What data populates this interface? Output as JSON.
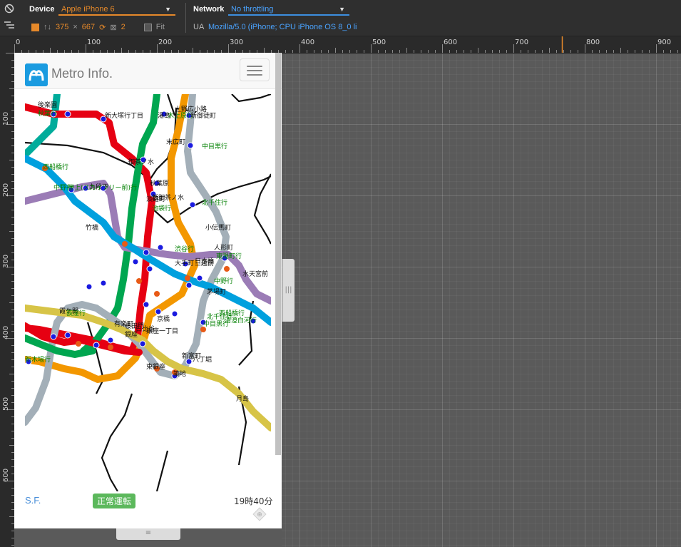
{
  "toolbar": {
    "device_label": "Device",
    "device_value": "Apple iPhone 6",
    "network_label": "Network",
    "network_value": "No throttling",
    "width": "375",
    "times": "×",
    "height": "667",
    "dpr": "2",
    "fit_label": "Fit",
    "ua_label": "UA",
    "ua_value": "Mozilla/5.0 (iPhone; CPU iPhone OS 8_0 li"
  },
  "ruler_top_labels": [
    "0",
    "100",
    "200",
    "300",
    "400",
    "500",
    "600",
    "700",
    "800",
    "900"
  ],
  "ruler_left_labels": [
    "100",
    "200",
    "300",
    "400",
    "500",
    "600"
  ],
  "app": {
    "brand": "Metro Info.",
    "footer_left": "S.F.",
    "status": "正常運転",
    "time": "19時40分"
  },
  "map": {
    "colors": {
      "red": "#e60012",
      "green": "#00a650",
      "orange": "#f39700",
      "gray": "#a3afb8",
      "purple": "#9b7cb6",
      "sky": "#00a0de",
      "teal": "#00ac9b",
      "gold": "#d7c447",
      "station": "#1a1adf",
      "train": "#e85a16",
      "label_green": "#008000"
    },
    "labels": [
      {
        "t": "後楽園",
        "c": "k"
      },
      {
        "t": "秋葉行",
        "c": "g"
      },
      {
        "t": "新大塚行丁目",
        "c": "k"
      },
      {
        "t": "上野広小路",
        "c": "k"
      },
      {
        "t": "湯島",
        "c": "k"
      },
      {
        "t": "木上原行",
        "c": "g"
      },
      {
        "t": "新御徒町",
        "c": "k"
      },
      {
        "t": "末広町",
        "c": "k"
      },
      {
        "t": "中目黒行",
        "c": "g"
      },
      {
        "t": "御茶ノ水",
        "c": "k"
      },
      {
        "t": "秋葉原",
        "c": "k"
      },
      {
        "t": "西船橋行",
        "c": "g"
      },
      {
        "t": "北千住行",
        "c": "g"
      },
      {
        "t": "中野行",
        "c": "g"
      },
      {
        "t": "九段下",
        "c": "k"
      },
      {
        "t": "押上(スカイツリー前)行",
        "c": "g"
      },
      {
        "t": "淡路町",
        "c": "k"
      },
      {
        "t": "新御茶ノ水",
        "c": "k"
      },
      {
        "t": "池袋行",
        "c": "g"
      },
      {
        "t": "竹橋",
        "c": "k"
      },
      {
        "t": "小伝馬町",
        "c": "k"
      },
      {
        "t": "渋谷行",
        "c": "g"
      },
      {
        "t": "大手町",
        "c": "k"
      },
      {
        "t": "三越前",
        "c": "k"
      },
      {
        "t": "人形町",
        "c": "k"
      },
      {
        "t": "東陽町行",
        "c": "g"
      },
      {
        "t": "中野行",
        "c": "g"
      },
      {
        "t": "水天宮前",
        "c": "k"
      },
      {
        "t": "茅場町",
        "c": "k"
      },
      {
        "t": "日本橋",
        "c": "k"
      },
      {
        "t": "西船橋行",
        "c": "g"
      },
      {
        "t": "銀座一丁目",
        "c": "k"
      },
      {
        "t": "有楽町",
        "c": "k"
      },
      {
        "t": "中目黒行",
        "c": "g"
      },
      {
        "t": "桜田門",
        "c": "k"
      },
      {
        "t": "京橋",
        "c": "k"
      },
      {
        "t": "霞ケ関",
        "c": "k"
      },
      {
        "t": "銀座",
        "c": "k"
      },
      {
        "t": "築地",
        "c": "k"
      },
      {
        "t": "東銀座",
        "c": "k"
      },
      {
        "t": "新富町",
        "c": "k"
      },
      {
        "t": "八丁堀",
        "c": "k"
      },
      {
        "t": "月島",
        "c": "k"
      },
      {
        "t": "荻窪行",
        "c": "g"
      },
      {
        "t": "新木場行",
        "c": "g"
      },
      {
        "t": "北千住行",
        "c": "g"
      },
      {
        "t": "日比谷",
        "c": "k"
      },
      {
        "t": "清澄白河行",
        "c": "g"
      }
    ]
  }
}
